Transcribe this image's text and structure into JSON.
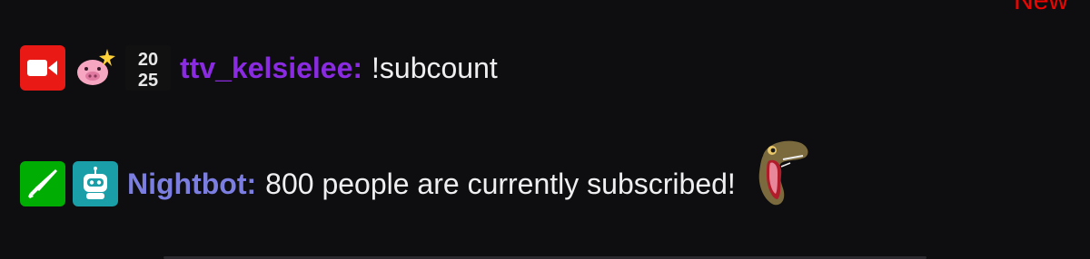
{
  "header": {
    "new_label": "New"
  },
  "colors": {
    "background": "#0e0e10",
    "new_label": "#eb0400",
    "user1_name": "#8a2be2",
    "user2_name": "#7b7ee0",
    "message_text": "#efeff1"
  },
  "messages": [
    {
      "badges": [
        "broadcaster-icon",
        "pig-sparkle-icon",
        "year-2025-icon"
      ],
      "username": "ttv_kelsielee",
      "colon": ":",
      "text": "!subcount",
      "year_badge_top": "20",
      "year_badge_bottom": "25"
    },
    {
      "badges": [
        "moderator-sword-icon",
        "verified-bot-icon"
      ],
      "username": "Nightbot",
      "colon": ":",
      "text": "800 people are currently subscribed!",
      "emote": "dinosaur-emote"
    }
  ]
}
